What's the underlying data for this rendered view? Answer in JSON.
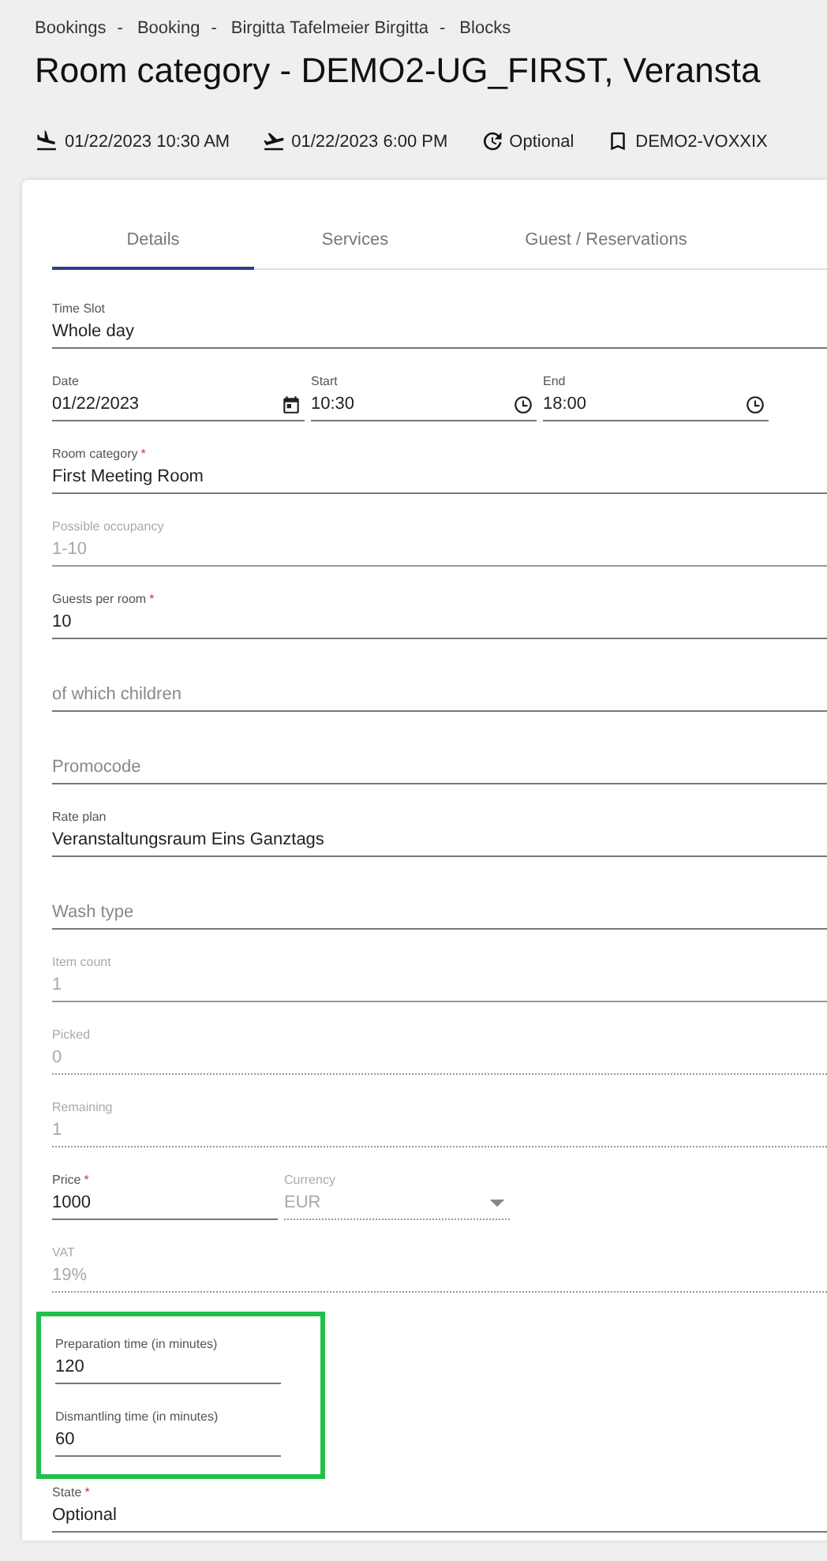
{
  "breadcrumbs": [
    {
      "label": "Bookings",
      "separator": "-"
    },
    {
      "label": "Booking",
      "separator": "-"
    },
    {
      "label": "Birgitta Tafelmeier Birgitta",
      "separator": "-"
    },
    {
      "label": "Blocks"
    }
  ],
  "title": "Room category - DEMO2-UG_FIRST, Veransta",
  "info": [
    {
      "kind": "arrival",
      "text": "01/22/2023 10:30 AM"
    },
    {
      "kind": "departure",
      "text": "01/22/2023 6:00 PM"
    },
    {
      "kind": "status",
      "text": "Optional"
    },
    {
      "kind": "booking",
      "text": "DEMO2-VOXXIX"
    }
  ],
  "tabs": [
    {
      "label": "Details",
      "selected": true
    },
    {
      "label": "Services",
      "selected": false
    },
    {
      "label": "Guest / Reservations",
      "selected": false
    }
  ],
  "form": [
    {
      "kind": "field",
      "label": "Time Slot",
      "value": "Whole day"
    },
    {
      "kind": "row",
      "fields": [
        {
          "kind": "date",
          "label": "Date",
          "value": "01/22/2023"
        },
        {
          "kind": "time",
          "label": "Start",
          "value": "10:30"
        },
        {
          "kind": "time",
          "label": "End",
          "value": "18:00"
        }
      ]
    },
    {
      "kind": "field",
      "label": "Room category",
      "asterisk": "*",
      "value": "First Meeting Room"
    },
    {
      "kind": "field",
      "label": "Possible occupancy",
      "value": "1-10",
      "disabled": true
    },
    {
      "kind": "field",
      "label": "Guests per room",
      "asterisk": "*",
      "value": "10"
    },
    {
      "kind": "field",
      "placeholder": "of which children"
    },
    {
      "kind": "field",
      "placeholder": "Promocode"
    },
    {
      "kind": "field",
      "label": "Rate plan",
      "value": "Veranstaltungsraum Eins Ganztags"
    },
    {
      "kind": "field",
      "placeholder": "Wash type"
    },
    {
      "kind": "field",
      "label": "Item count",
      "value": "1",
      "disabled": true
    },
    {
      "kind": "field",
      "label": "Picked",
      "value": "0",
      "disabled": true,
      "readonly": true
    },
    {
      "kind": "field",
      "label": "Remaining",
      "value": "1",
      "disabled": true,
      "readonly": true
    },
    {
      "kind": "row",
      "fields": [
        {
          "kind": "text",
          "label": "Price",
          "asterisk": "*",
          "value": "1000"
        },
        {
          "kind": "select",
          "label": "Currency",
          "value": "EUR",
          "disabled": true,
          "readonly": true
        }
      ]
    },
    {
      "kind": "field",
      "label": "VAT",
      "value": "19%",
      "disabled": true,
      "readonly": true
    },
    {
      "kind": "highlight",
      "fields": [
        {
          "label": "Preparation time (in minutes)",
          "value": "120"
        },
        {
          "label": "Dismantling time (in minutes)",
          "value": "60"
        }
      ]
    },
    {
      "kind": "field",
      "label": "State",
      "asterisk": "*",
      "value": "Optional"
    }
  ]
}
